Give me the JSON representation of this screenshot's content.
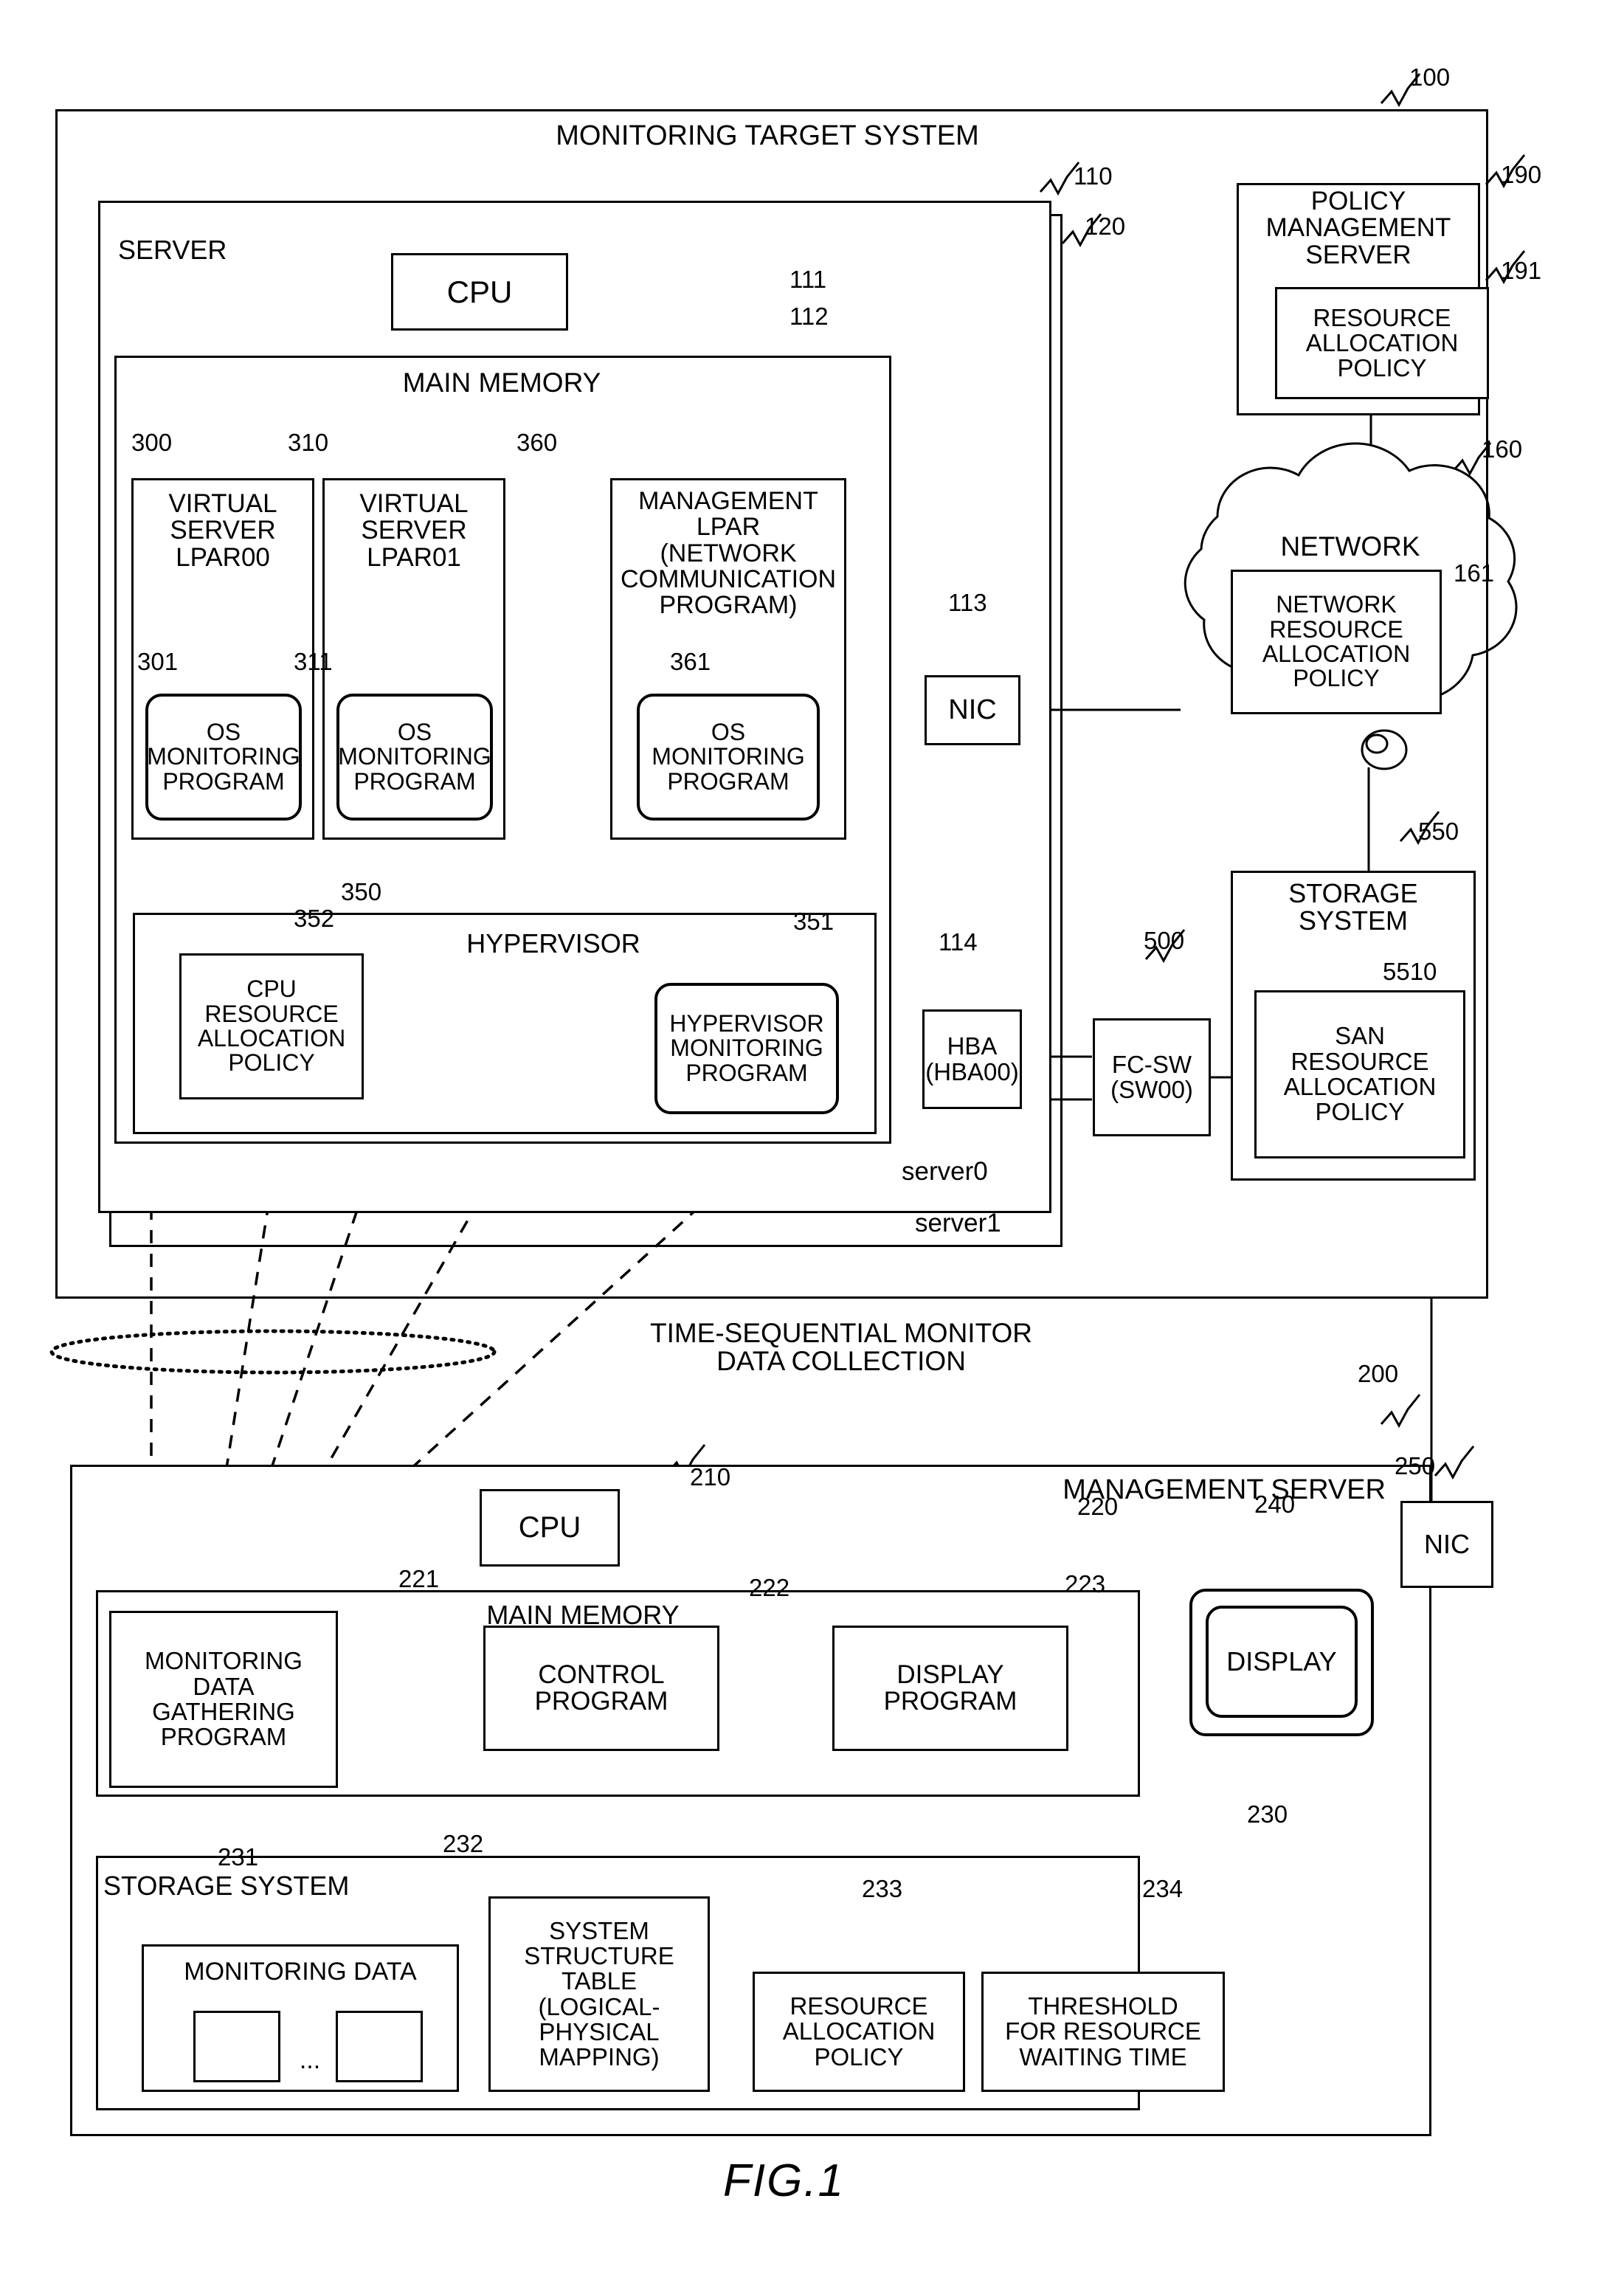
{
  "figure": {
    "caption": "FIG.1"
  },
  "monitoring_target_system": {
    "title": "MONITORING TARGET SYSTEM",
    "ref": "100",
    "server": {
      "title": "SERVER",
      "ref_front": "110",
      "ref_back": "120",
      "label_server0": "server0",
      "label_server1": "server1",
      "cpu": {
        "label": "CPU",
        "ref": "111"
      },
      "main_memory": {
        "title": "MAIN MEMORY",
        "ref": "112",
        "lpars": [
          {
            "ref": "300",
            "title": "VIRTUAL\nSERVER\nLPAR00",
            "program_ref": "301",
            "program": "OS\nMONITORING\nPROGRAM"
          },
          {
            "ref": "310",
            "title": "VIRTUAL\nSERVER\nLPAR01",
            "program_ref": "311",
            "program": "OS\nMONITORING\nPROGRAM"
          },
          {
            "ref": "360",
            "title": "MANAGEMENT\nLPAR\n(NETWORK\nCOMMUNICATION\nPROGRAM)",
            "program_ref": "361",
            "program": "OS\nMONITORING\nPROGRAM"
          }
        ],
        "hypervisor": {
          "title": "HYPERVISOR",
          "ref": "350",
          "cpu_policy": {
            "ref": "352",
            "label": "CPU\nRESOURCE\nALLOCATION\nPOLICY"
          },
          "monitoring_program": {
            "ref": "351",
            "label": "HYPERVISOR\nMONITORING\nPROGRAM"
          }
        }
      },
      "nic": {
        "label": "NIC",
        "ref": "113"
      },
      "hba": {
        "label": "HBA\n(HBA00)",
        "ref": "114"
      }
    },
    "policy_management_server": {
      "title": "POLICY\nMANAGEMENT\nSERVER",
      "ref": "190",
      "policy": {
        "label": "RESOURCE\nALLOCATION\nPOLICY",
        "ref": "191"
      }
    },
    "network": {
      "title": "NETWORK",
      "ref": "160",
      "policy": {
        "label": "NETWORK\nRESOURCE\nALLOCATION\nPOLICY",
        "ref": "161"
      }
    },
    "fc_sw": {
      "label": "FC-SW\n(SW00)",
      "ref": "500"
    },
    "storage_system": {
      "title": "STORAGE\nSYSTEM",
      "ref": "550",
      "policy": {
        "label": "SAN\nRESOURCE\nALLOCATION\nPOLICY",
        "ref": "5510"
      }
    }
  },
  "collection_label": "TIME-SEQUENTIAL MONITOR\nDATA COLLECTION",
  "management_server": {
    "title": "MANAGEMENT SERVER",
    "ref": "200",
    "cpu": {
      "label": "CPU",
      "ref": "210"
    },
    "nic": {
      "label": "NIC",
      "ref": "250"
    },
    "display": {
      "label": "DISPLAY",
      "ref": "240"
    },
    "main_memory": {
      "title": "MAIN MEMORY",
      "ref": "220",
      "gathering_program": {
        "label": "MONITORING\nDATA\nGATHERING\nPROGRAM",
        "ref": "221"
      },
      "control_program": {
        "label": "CONTROL\nPROGRAM",
        "ref": "222"
      },
      "display_program": {
        "label": "DISPLAY\nPROGRAM",
        "ref": "223"
      }
    },
    "storage_system": {
      "title": "STORAGE SYSTEM",
      "ref": "230",
      "monitoring_data": {
        "label": "MONITORING DATA",
        "ref": "231",
        "ellipsis": "..."
      },
      "system_structure_table": {
        "label": "SYSTEM\nSTRUCTURE\nTABLE\n(LOGICAL-\nPHYSICAL\nMAPPING)",
        "ref": "232"
      },
      "resource_allocation_policy": {
        "label": "RESOURCE\nALLOCATION\nPOLICY",
        "ref": "233"
      },
      "threshold": {
        "label": "THRESHOLD\nFOR RESOURCE\nWAITING TIME",
        "ref": "234"
      }
    }
  }
}
